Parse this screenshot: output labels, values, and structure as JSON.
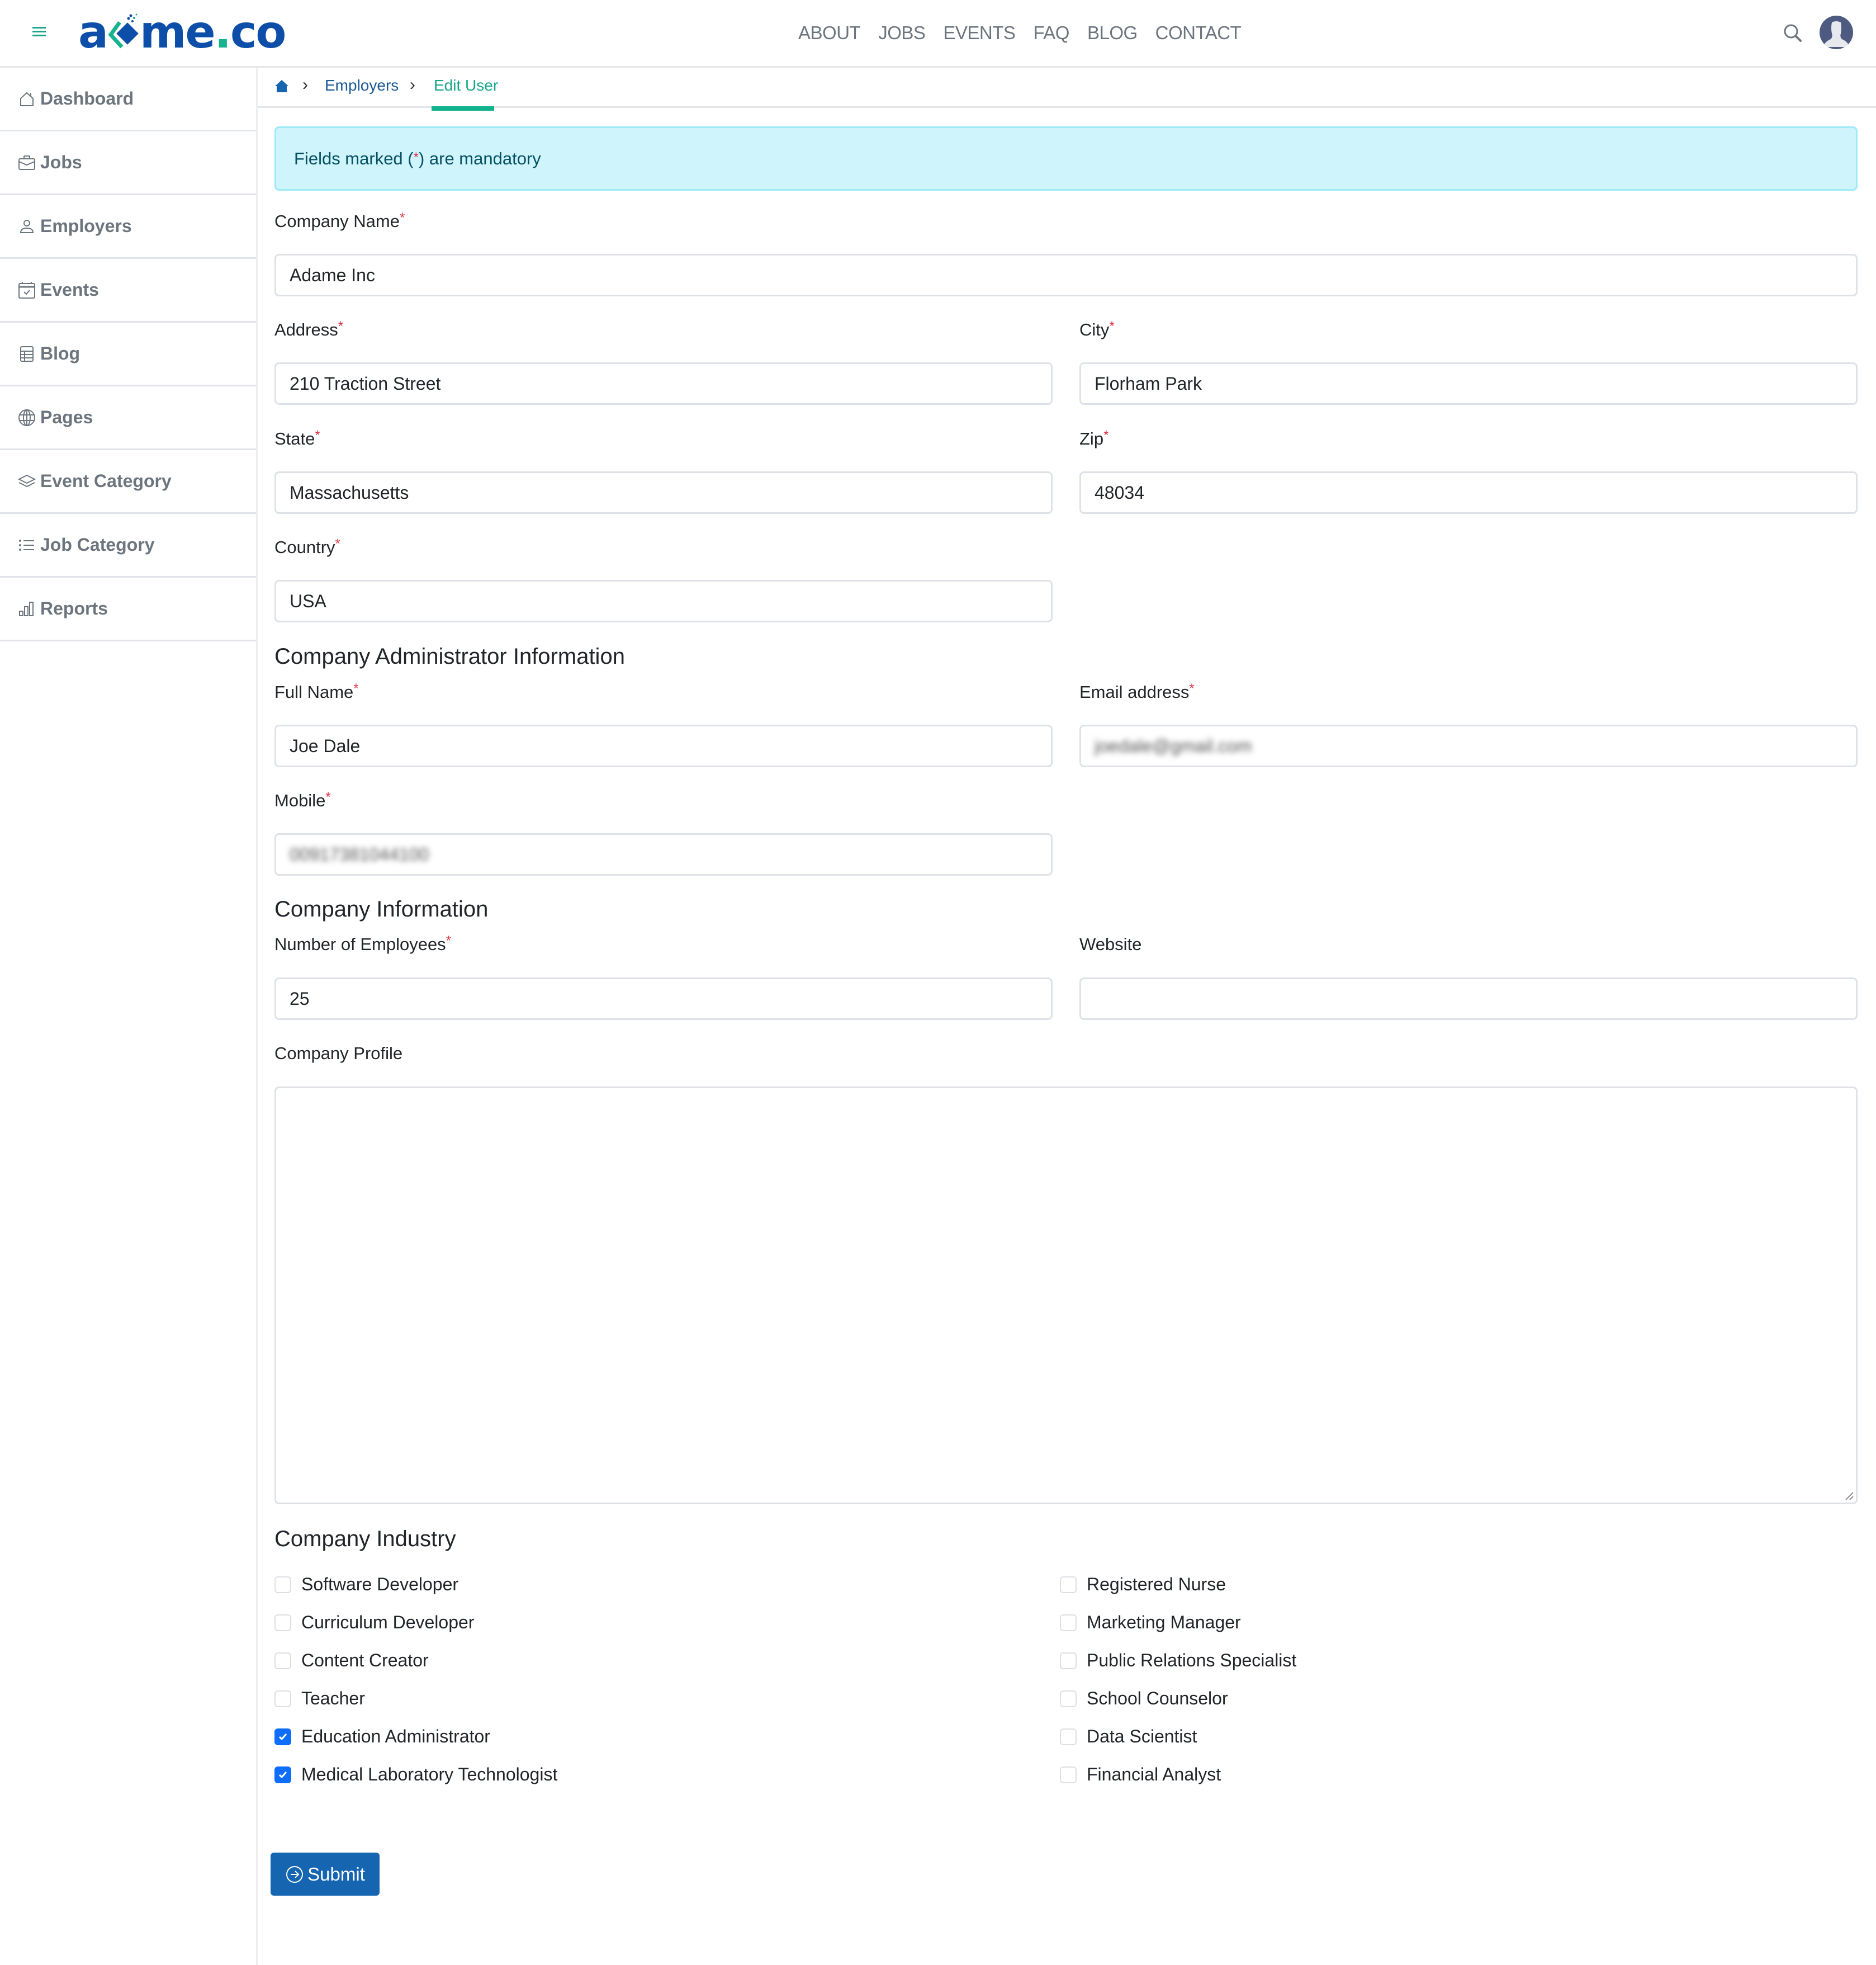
{
  "header": {
    "logo_text_a": "a",
    "logo_text_rest": "me",
    "logo_dot": ".",
    "logo_tld": "co",
    "nav": [
      "ABOUT",
      "JOBS",
      "EVENTS",
      "FAQ",
      "BLOG",
      "CONTACT"
    ]
  },
  "sidebar": {
    "items": [
      {
        "label": "Dashboard",
        "icon": "home-icon"
      },
      {
        "label": "Jobs",
        "icon": "briefcase-icon"
      },
      {
        "label": "Employers",
        "icon": "person-icon"
      },
      {
        "label": "Events",
        "icon": "calendar-check-icon"
      },
      {
        "label": "Blog",
        "icon": "layout-table-icon"
      },
      {
        "label": "Pages",
        "icon": "globe-icon"
      },
      {
        "label": "Event Category",
        "icon": "layers-icon"
      },
      {
        "label": "Job Category",
        "icon": "list-icon"
      },
      {
        "label": "Reports",
        "icon": "bar-chart-icon"
      }
    ]
  },
  "breadcrumb": {
    "home_icon": "home-icon",
    "items": [
      "Employers",
      "Edit User"
    ]
  },
  "alert": {
    "text_before": "Fields marked (",
    "asterisk": "*",
    "text_after": ") are mandatory"
  },
  "form": {
    "required_mark": "*",
    "company_name": {
      "label": "Company Name",
      "value": "Adame Inc"
    },
    "address": {
      "label": "Address",
      "value": "210 Traction Street"
    },
    "city": {
      "label": "City",
      "value": "Florham Park"
    },
    "state": {
      "label": "State",
      "value": "Massachusetts"
    },
    "zip": {
      "label": "Zip",
      "value": "48034"
    },
    "country": {
      "label": "Country",
      "value": "USA"
    },
    "admin_heading": "Company Administrator Information",
    "full_name": {
      "label": "Full Name",
      "value": "Joe Dale"
    },
    "email": {
      "label": "Email address",
      "value": "joedale@gmail.com"
    },
    "mobile": {
      "label": "Mobile",
      "value": "00917381044100"
    },
    "company_heading": "Company Information",
    "employees": {
      "label": "Number of Employees",
      "value": "25"
    },
    "website": {
      "label": "Website",
      "value": ""
    },
    "profile": {
      "label": "Company Profile",
      "value": ""
    },
    "industry_heading": "Company Industry",
    "industries_left": [
      {
        "label": "Software Developer",
        "checked": false
      },
      {
        "label": "Curriculum Developer",
        "checked": false
      },
      {
        "label": "Content Creator",
        "checked": false
      },
      {
        "label": "Teacher",
        "checked": false
      },
      {
        "label": "Education Administrator",
        "checked": true
      },
      {
        "label": "Medical Laboratory Technologist",
        "checked": true
      }
    ],
    "industries_right": [
      {
        "label": "Registered Nurse",
        "checked": false
      },
      {
        "label": "Marketing Manager",
        "checked": false
      },
      {
        "label": "Public Relations Specialist",
        "checked": false
      },
      {
        "label": "School Counselor",
        "checked": false
      },
      {
        "label": "Data Scientist",
        "checked": false
      },
      {
        "label": "Financial Analyst",
        "checked": false
      }
    ],
    "submit_label": "Submit"
  },
  "colors": {
    "brand_blue": "#0d4ea8",
    "brand_teal": "#16b38e",
    "primary_button": "#1565b0",
    "checkbox_checked": "#0d6efd",
    "alert_bg": "#cff4fc",
    "required": "#dc3545"
  }
}
